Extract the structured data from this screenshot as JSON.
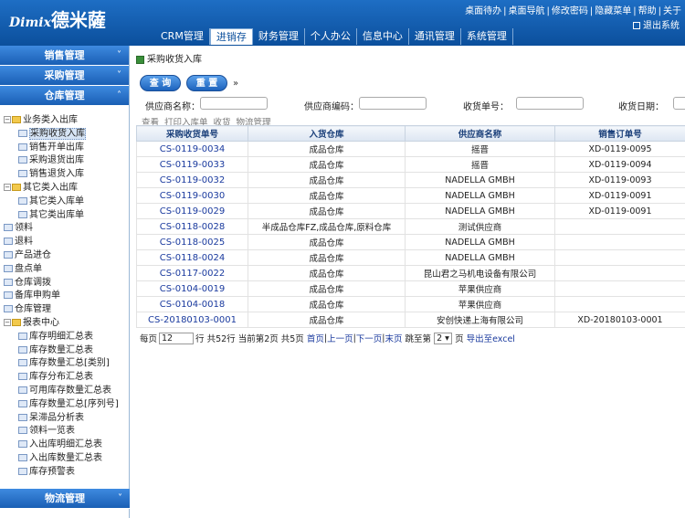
{
  "header": {
    "logo_en": "Dimix",
    "logo_cn": "德米薩",
    "links": [
      "桌面待办",
      "桌面导航",
      "修改密码",
      "隐藏菜单",
      "帮助",
      "关于"
    ],
    "logout": "退出系统",
    "nav": [
      "CRM管理",
      "进销存",
      "财务管理",
      "个人办公",
      "信息中心",
      "通讯管理",
      "系统管理"
    ]
  },
  "sidebar": {
    "sections": [
      "销售管理",
      "采购管理",
      "仓库管理"
    ],
    "bottom_section": "物流管理",
    "tree": [
      {
        "label": "业务类入出库",
        "type": "folder",
        "level": 1
      },
      {
        "label": "采购收货入库",
        "type": "doc",
        "level": 2,
        "selected": true
      },
      {
        "label": "销售开单出库",
        "type": "doc",
        "level": 2
      },
      {
        "label": "采购退货出库",
        "type": "doc",
        "level": 2
      },
      {
        "label": "销售退货入库",
        "type": "doc",
        "level": 2
      },
      {
        "label": "其它类入出库",
        "type": "folder",
        "level": 1
      },
      {
        "label": "其它类入库单",
        "type": "doc",
        "level": 2
      },
      {
        "label": "其它类出库单",
        "type": "doc",
        "level": 2
      },
      {
        "label": "领料",
        "type": "doc",
        "level": 1
      },
      {
        "label": "退料",
        "type": "doc",
        "level": 1
      },
      {
        "label": "产品进仓",
        "type": "doc",
        "level": 1
      },
      {
        "label": "盘点单",
        "type": "doc",
        "level": 1
      },
      {
        "label": "仓库调拨",
        "type": "doc",
        "level": 1
      },
      {
        "label": "备库申购单",
        "type": "doc",
        "level": 1
      },
      {
        "label": "仓库管理",
        "type": "doc",
        "level": 1
      },
      {
        "label": "报表中心",
        "type": "folder",
        "level": 1
      },
      {
        "label": "库存明细汇总表",
        "type": "doc",
        "level": 2
      },
      {
        "label": "库存数量汇总表",
        "type": "doc",
        "level": 2
      },
      {
        "label": "库存数量汇总[类别]",
        "type": "doc",
        "level": 2
      },
      {
        "label": "库存分布汇总表",
        "type": "doc",
        "level": 2
      },
      {
        "label": "可用库存数量汇总表",
        "type": "doc",
        "level": 2
      },
      {
        "label": "库存数量汇总[序列号]",
        "type": "doc",
        "level": 2
      },
      {
        "label": "呆滞品分析表",
        "type": "doc",
        "level": 2
      },
      {
        "label": "领料一览表",
        "type": "doc",
        "level": 2
      },
      {
        "label": "入出库明细汇总表",
        "type": "doc",
        "level": 2
      },
      {
        "label": "入出库数量汇总表",
        "type": "doc",
        "level": 2
      },
      {
        "label": "库存预警表",
        "type": "doc",
        "level": 2
      }
    ]
  },
  "main": {
    "title": "采购收货入库",
    "query_button": "查 询",
    "reset_button": "重 置",
    "more_symbol": "»",
    "filters": [
      "供应商名称：",
      "供应商编码：",
      "收货单号：",
      "收货日期："
    ],
    "toolbar": [
      "查看",
      "打印入库单",
      "收货",
      "物流管理"
    ],
    "columns": [
      "采购收货单号",
      "入货仓库",
      "供应商名称",
      "销售订单号"
    ],
    "rows": [
      [
        "CS-0119-0034",
        "成品仓库",
        "摇晋",
        "XD-0119-0095"
      ],
      [
        "CS-0119-0033",
        "成品仓库",
        "摇晋",
        "XD-0119-0094"
      ],
      [
        "CS-0119-0032",
        "成品仓库",
        "NADELLA GMBH",
        "XD-0119-0093"
      ],
      [
        "CS-0119-0030",
        "成品仓库",
        "NADELLA GMBH",
        "XD-0119-0091"
      ],
      [
        "CS-0119-0029",
        "成品仓库",
        "NADELLA GMBH",
        "XD-0119-0091"
      ],
      [
        "CS-0118-0028",
        "半成品仓库FZ,成品仓库,原料仓库",
        "测试供应商",
        ""
      ],
      [
        "CS-0118-0025",
        "成品仓库",
        "NADELLA GMBH",
        ""
      ],
      [
        "CS-0118-0024",
        "成品仓库",
        "NADELLA GMBH",
        ""
      ],
      [
        "CS-0117-0022",
        "成品仓库",
        "昆山君之马机电设备有限公司",
        ""
      ],
      [
        "CS-0104-0019",
        "成品仓库",
        "苹果供应商",
        ""
      ],
      [
        "CS-0104-0018",
        "成品仓库",
        "苹果供应商",
        ""
      ],
      [
        "CS-20180103-0001",
        "成品仓库",
        "安创快递上海有限公司",
        "XD-20180103-0001"
      ]
    ],
    "pager": {
      "per_page_label": "每页",
      "per_page": "12",
      "row_label": "行",
      "total": "共52行",
      "current": "当前第2页",
      "pages": "共5页",
      "first": "首页",
      "prev": "上一页",
      "next": "下一页",
      "last": "末页",
      "jump_label": "跳至第",
      "jump_value": "2",
      "page_unit": "页",
      "export": "导出至excel"
    }
  }
}
